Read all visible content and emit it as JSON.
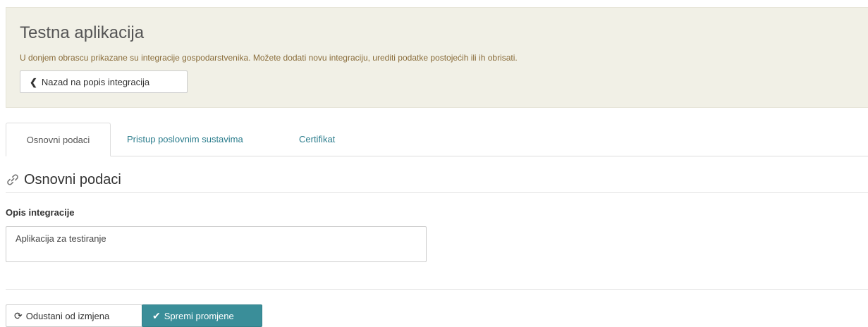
{
  "header": {
    "title": "Testna aplikacija",
    "description": "U donjem obrascu prikazane su integracije gospodarstvenika. Možete dodati novu integraciju, urediti podatke postojećih ili ih obrisati.",
    "back_label": "Nazad na popis integracija"
  },
  "tabs": [
    {
      "label": "Osnovni podaci",
      "active": true
    },
    {
      "label": "Pristup poslovnim sustavima",
      "active": false
    },
    {
      "label": "Certifikat",
      "active": false
    }
  ],
  "section": {
    "icon": "link-icon",
    "title": "Osnovni podaci"
  },
  "form": {
    "description_label": "Opis integracije",
    "description_value": "Aplikacija za testiranje"
  },
  "actions": {
    "cancel_label": "Odustani od izmjena",
    "save_label": "Spremi promjene"
  },
  "colors": {
    "header_bg": "#f1f0e6",
    "description_text": "#8a6d3b",
    "link": "#2a7c8c",
    "primary": "#3a8e99"
  }
}
